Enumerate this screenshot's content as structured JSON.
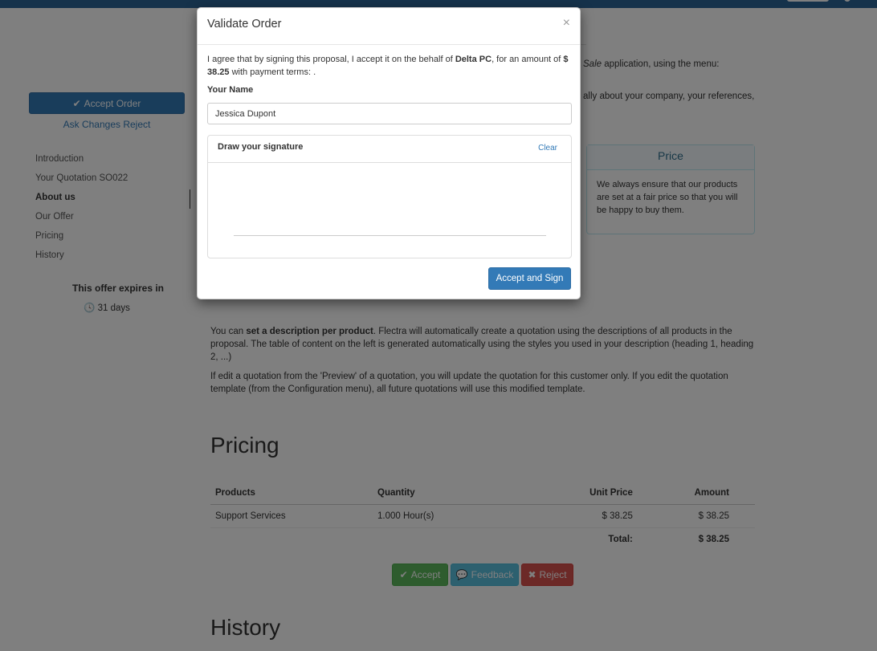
{
  "sidebar": {
    "accept_order_label": "Accept Order",
    "ask_changes_label": "Ask Changes",
    "reject_label": "Reject",
    "toc": [
      {
        "label": "Introduction",
        "active": false
      },
      {
        "label": "Your Quotation SO022",
        "active": false
      },
      {
        "label": "About us",
        "active": true
      },
      {
        "label": "Our Offer",
        "active": false
      },
      {
        "label": "Pricing",
        "active": false
      },
      {
        "label": "History",
        "active": false
      }
    ],
    "expires_label": "This offer expires in",
    "expires_value": "31 days"
  },
  "main": {
    "frag1_before": "Sale",
    "frag1_after": " application, using the menu:",
    "frag2": "ally about your company, your references,",
    "price_panel": {
      "title": "Price",
      "body": "We always ensure that our products are set at a fair price so that you will be happy to buy them."
    },
    "para1_prefix": "You can ",
    "para1_bold": "set a description per product",
    "para1_rest": ". Flectra will automatically create a quotation using the descriptions of all products in the proposal. The table of content on the left is generated automatically using the styles you used in your description (heading 1, heading 2, ...)",
    "para2": "If edit a quotation from the 'Preview' of a quotation, you will update the quotation for this customer only. If you edit the quotation template (from the Configuration menu), all future quotations will use this modified template.",
    "pricing_heading": "Pricing",
    "table": {
      "headers": [
        "Products",
        "Quantity",
        "Unit Price",
        "Amount"
      ],
      "rows": [
        [
          "Support Services",
          "1.000 Hour(s)",
          "$ 38.25",
          "$ 38.25"
        ]
      ],
      "total_label": "Total:",
      "total_value": "$ 38.25"
    },
    "buttons": {
      "accept": "Accept",
      "feedback": "Feedback",
      "reject": "Reject"
    },
    "history_heading": "History"
  },
  "modal": {
    "title": "Validate Order",
    "close": "×",
    "agree_prefix": "I agree that by signing this proposal, I accept it on the behalf of ",
    "company": "Delta PC",
    "amount_prefix": ", for an amount of ",
    "amount": "$ 38.25",
    "payment_terms": " with payment terms: .",
    "name_label": "Your Name",
    "name_value": "Jessica Dupont",
    "signature_title": "Draw your signature",
    "clear_label": "Clear",
    "sign_button": "Accept and Sign"
  },
  "colors": {
    "primary": "#337ab7",
    "success": "#5cb85c",
    "info": "#5bc0de",
    "danger": "#d9534f",
    "topbar": "#2a6496"
  }
}
